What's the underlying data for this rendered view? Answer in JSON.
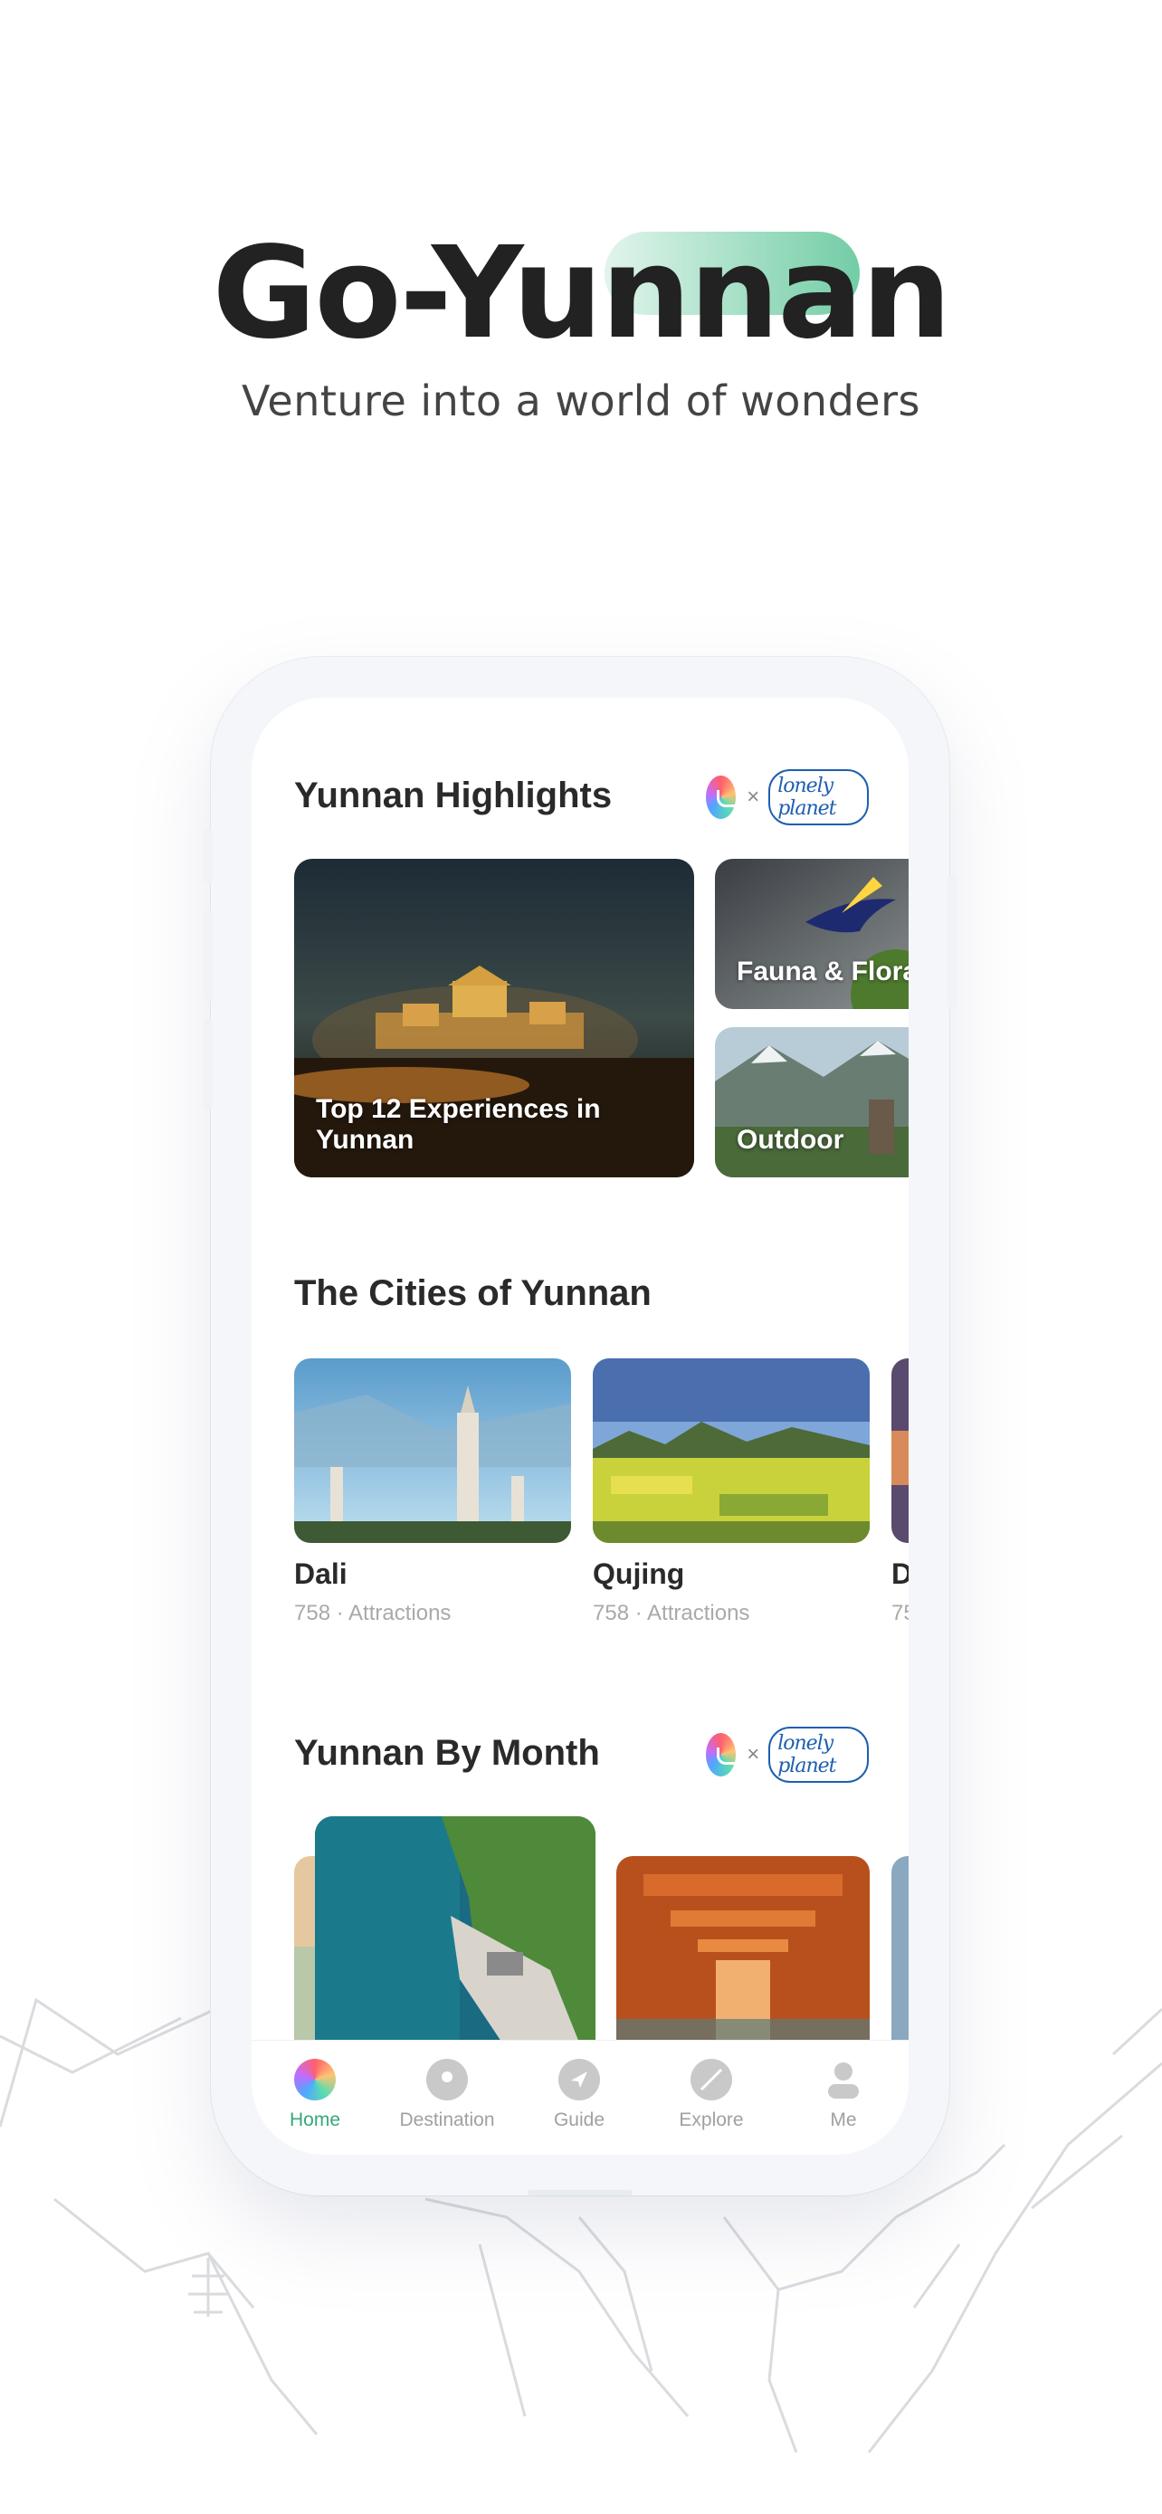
{
  "hero": {
    "title": "Go-Yunnan",
    "subtitle": "Venture into a world of wonders"
  },
  "highlights": {
    "title": "Yunnan Highlights",
    "partner_separator": "×",
    "partner_logo": "lonely planet",
    "cards": [
      {
        "label": "Top 12 Experiences in Yunnan",
        "icon": "temple-image"
      },
      {
        "label": "Fauna & Flora",
        "icon": "bird-image"
      },
      {
        "label": "Outdoor",
        "icon": "mountain-image"
      }
    ]
  },
  "cities": {
    "title": "The Cities of Yunnan",
    "items": [
      {
        "name": "Dali",
        "sub": "758 · Attractions"
      },
      {
        "name": "Qujing",
        "sub": "758 · Attractions"
      },
      {
        "name": "D",
        "sub": "75"
      }
    ]
  },
  "by_month": {
    "title": "Yunnan By Month",
    "partner_separator": "×",
    "partner_logo": "lonely planet"
  },
  "tabbar": {
    "items": [
      {
        "label": "Home",
        "icon": "home-logo-icon",
        "active": true
      },
      {
        "label": "Destination",
        "icon": "location-pin-icon"
      },
      {
        "label": "Guide",
        "icon": "navigation-arrow-icon"
      },
      {
        "label": "Explore",
        "icon": "explore-leaf-icon"
      },
      {
        "label": "Me",
        "icon": "person-icon"
      }
    ]
  },
  "colors": {
    "accent": "#37a77a",
    "text": "#2a2a2a",
    "muted": "#a9a9a9"
  }
}
